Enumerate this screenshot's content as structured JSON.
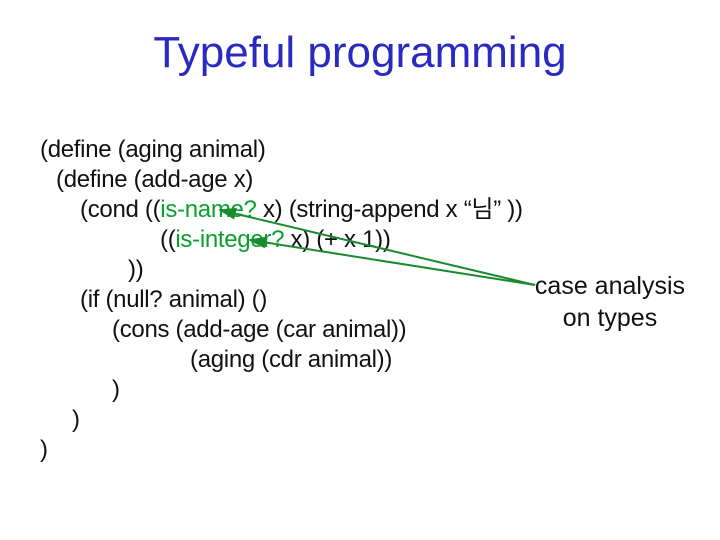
{
  "title": "Typeful programming",
  "code": {
    "l1": "(define (aging animal)",
    "l2": "(define (add-age x)",
    "l3_pre": "(cond ((",
    "l3_hl": "is-name?",
    "l3_post": " x) (string-append x  “님” ))",
    "l4_pre": "((",
    "l4_hl": "is-integer?",
    "l4_post": " x) (+ x 1))",
    "l5": "))",
    "l6": "(if (null? animal) ()",
    "l7": "(cons (add-age (car animal))",
    "l8": "(aging (cdr animal))",
    "l9": ")",
    "l10": ")",
    "l11": ")"
  },
  "annotation": {
    "line1": "case analysis",
    "line2": "on types"
  },
  "colors": {
    "title": "#2a2ac0",
    "highlight": "#0aa030",
    "arrow": "#1a8a2e"
  }
}
